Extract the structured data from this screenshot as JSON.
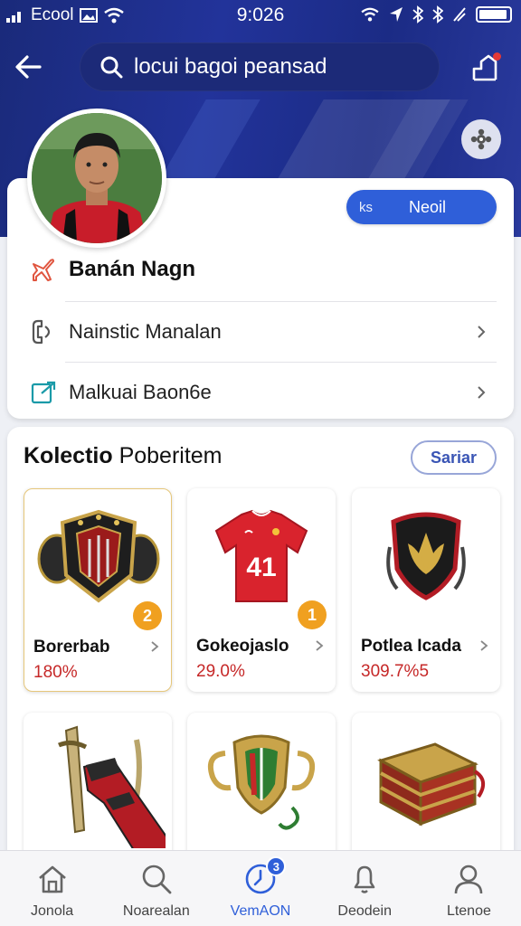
{
  "status_bar": {
    "carrier": "Ecool",
    "time": "9:026"
  },
  "search": {
    "placeholder": "locui bagoi peansad"
  },
  "profile": {
    "follow_prefix": "ks",
    "follow_label": "Neoil",
    "name": "Banán Nagn",
    "menu": [
      {
        "label": "Nainstic Manalan",
        "icon": "phone-icon"
      },
      {
        "label": "Malkuai Baon6e",
        "icon": "edit-box-icon"
      }
    ]
  },
  "collection": {
    "title_bold": "Kolectio",
    "title_rest": " Poberitem",
    "see_all": "Sariar",
    "items": [
      {
        "name": "Borerbab",
        "price": "180%",
        "badge": "2",
        "icon": "shoulder-armor-icon"
      },
      {
        "name": "Gokeojaslo",
        "price": "29.0%",
        "badge": "1",
        "icon": "red-jersey-icon",
        "jersey_number": "41"
      },
      {
        "name": "Potlea Icada",
        "price": "309.7%5",
        "badge": "",
        "icon": "crest-shield-icon"
      },
      {
        "name": "",
        "price": "",
        "badge": "",
        "icon": "gauntlet-sword-icon"
      },
      {
        "name": "",
        "price": "",
        "badge": "",
        "icon": "trophy-shield-icon"
      },
      {
        "name": "",
        "price": "",
        "badge": "",
        "icon": "treasure-chest-icon"
      }
    ]
  },
  "bottom_nav": {
    "items": [
      {
        "label": "Jonola",
        "icon": "home-icon"
      },
      {
        "label": "Noarealan",
        "icon": "search-icon"
      },
      {
        "label": "VemAON",
        "icon": "clock-icon",
        "badge": "3",
        "active": true
      },
      {
        "label": "Deodein",
        "icon": "bell-icon"
      },
      {
        "label": "Ltenoe",
        "icon": "profile-icon"
      }
    ]
  },
  "colors": {
    "header_bg": "#1f2f8f",
    "accent": "#2f5fd9",
    "price": "#c62828",
    "badge": "#f0a020"
  }
}
